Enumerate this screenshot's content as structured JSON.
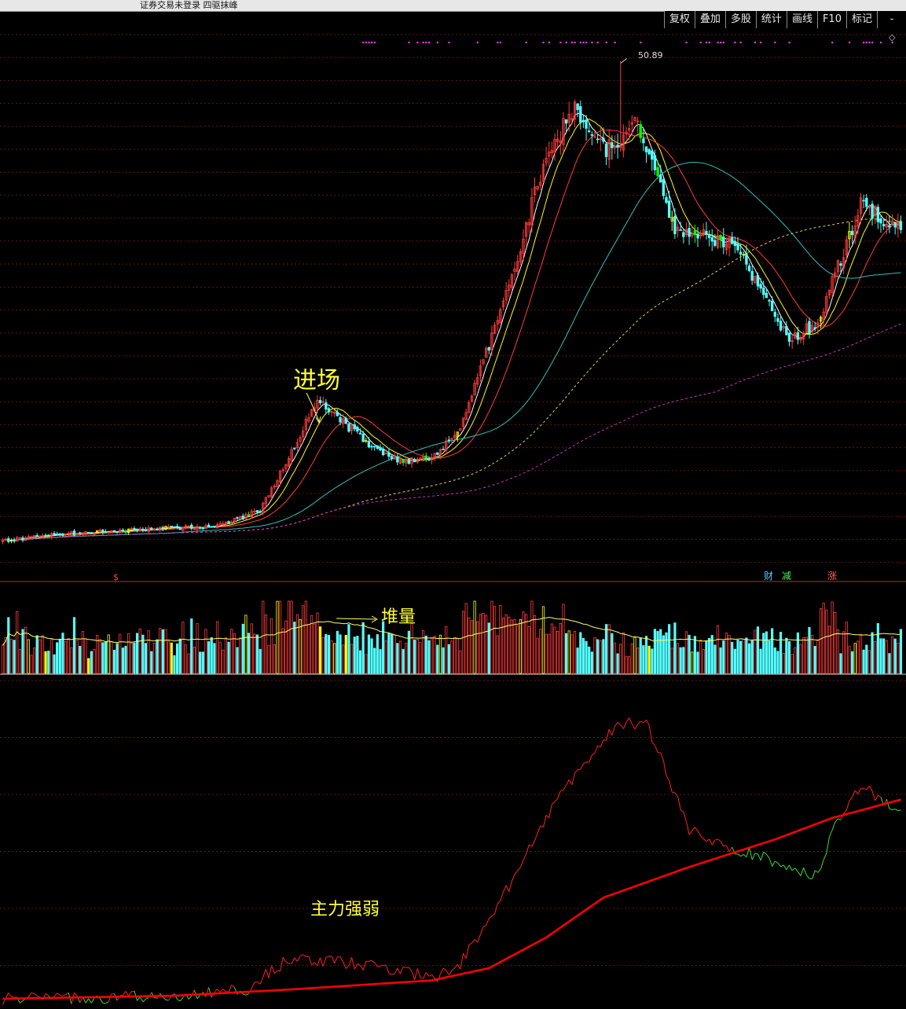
{
  "window": {
    "title": "证券交易未登录  四驱抹峰"
  },
  "toolbar": {
    "buttons": [
      "复权",
      "叠加",
      "多股",
      "统计",
      "画线",
      "F10",
      "标记",
      "-"
    ]
  },
  "annotations": {
    "entry": "进场",
    "volume_pile": "堆量",
    "strength": "主力强弱",
    "peak_price": "50.89"
  },
  "event_markers": {
    "dollar": "$",
    "finance": "财",
    "reduce": "减",
    "rise": "涨"
  },
  "colors": {
    "background": "#000000",
    "up": "#ff3b3b",
    "down": "#54ffff",
    "strong_bar": "#ffff00",
    "falling_highlight": "#00ff00",
    "ma5": "#ffffff",
    "ma10": "#ffff00",
    "ma20": "#ff3b3b",
    "ma60": "#30c0c0",
    "ma120": "#e0d040",
    "ma250": "#d030d0",
    "signal_dots": "#ff30ff",
    "strength_line": "#ff2020",
    "strength_avg": "#ff0000",
    "strength_weak": "#33dd33"
  },
  "chart_data": [
    {
      "type": "candlestick",
      "price_points": [
        {
          "i": 0,
          "p": 6.2
        },
        {
          "i": 20,
          "p": 6.8
        },
        {
          "i": 50,
          "p": 7.3
        },
        {
          "i": 75,
          "p": 7.6
        },
        {
          "i": 90,
          "p": 9.0
        },
        {
          "i": 110,
          "p": 19.2
        },
        {
          "i": 130,
          "p": 14.8
        },
        {
          "i": 140,
          "p": 13.5
        },
        {
          "i": 150,
          "p": 13.9
        },
        {
          "i": 160,
          "p": 16.8
        },
        {
          "i": 175,
          "p": 28.3
        },
        {
          "i": 190,
          "p": 42.0
        },
        {
          "i": 200,
          "p": 46.5
        },
        {
          "i": 210,
          "p": 42.5
        },
        {
          "i": 222,
          "p": 45.0
        },
        {
          "i": 235,
          "p": 35.0
        },
        {
          "i": 255,
          "p": 34.0
        },
        {
          "i": 275,
          "p": 25.0
        },
        {
          "i": 285,
          "p": 26.5
        },
        {
          "i": 300,
          "p": 37.6
        },
        {
          "i": 314,
          "p": 35.0
        }
      ],
      "peak_high": 50.89,
      "moving_averages": [
        "MA5",
        "MA10",
        "MA20",
        "MA60",
        "MA120",
        "MA250"
      ]
    },
    {
      "type": "bar",
      "title": "",
      "series": [
        {
          "values_shape": "volume",
          "average": "MA"
        }
      ],
      "highlight": "堆量"
    },
    {
      "type": "line",
      "title": "",
      "series": [
        {
          "role": "strength",
          "points": [
            {
              "i": 0,
              "v": 0.0
            },
            {
              "i": 30,
              "v": 0.3
            },
            {
              "i": 60,
              "v": 1.0
            },
            {
              "i": 85,
              "v": 3.0
            },
            {
              "i": 100,
              "v": 13.0
            },
            {
              "i": 130,
              "v": 11.0
            },
            {
              "i": 150,
              "v": 7.0
            },
            {
              "i": 158,
              "v": 9.0
            },
            {
              "i": 170,
              "v": 25.0
            },
            {
              "i": 180,
              "v": 42.0
            },
            {
              "i": 195,
              "v": 67.0
            },
            {
              "i": 205,
              "v": 78.0
            },
            {
              "i": 215,
              "v": 90.0
            },
            {
              "i": 225,
              "v": 90.0
            },
            {
              "i": 240,
              "v": 55.0
            },
            {
              "i": 255,
              "v": 48.0
            },
            {
              "i": 265,
              "v": 47.0
            },
            {
              "i": 275,
              "v": 42.0
            },
            {
              "i": 285,
              "v": 40.0
            },
            {
              "i": 290,
              "v": 55.0
            },
            {
              "i": 300,
              "v": 70.0
            },
            {
              "i": 308,
              "v": 64.0
            },
            {
              "i": 314,
              "v": 62.0
            }
          ]
        },
        {
          "role": "average",
          "points": [
            {
              "i": 0,
              "v": 0.0
            },
            {
              "i": 60,
              "v": 1.0
            },
            {
              "i": 100,
              "v": 3.0
            },
            {
              "i": 150,
              "v": 6.0
            },
            {
              "i": 170,
              "v": 10.0
            },
            {
              "i": 190,
              "v": 20.0
            },
            {
              "i": 210,
              "v": 33.0
            },
            {
              "i": 240,
              "v": 43.0
            },
            {
              "i": 270,
              "v": 52.0
            },
            {
              "i": 290,
              "v": 59.0
            },
            {
              "i": 314,
              "v": 65.0
            }
          ]
        }
      ],
      "label": "主力强弱"
    }
  ]
}
